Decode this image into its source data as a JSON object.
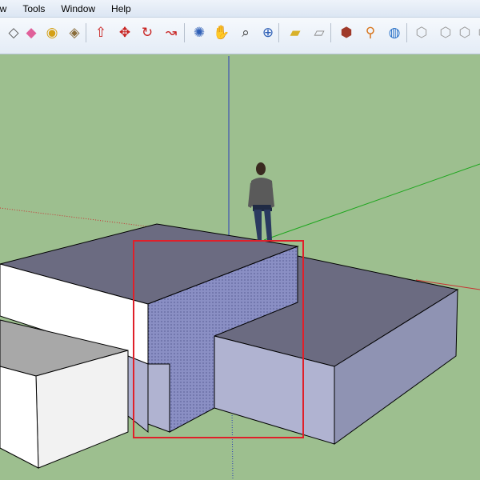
{
  "menu": {
    "items": [
      "aw",
      "Tools",
      "Window",
      "Help"
    ]
  },
  "toolbar": {
    "buttons": [
      {
        "name": "eraser-icon",
        "glyph": "◇",
        "color": "#555"
      },
      {
        "name": "eraser-pink-icon",
        "glyph": "◆",
        "color": "#e0609a"
      },
      {
        "name": "tape-measure-icon",
        "glyph": "◉",
        "color": "#d4a017"
      },
      {
        "name": "paint-bucket-icon",
        "glyph": "◈",
        "color": "#8a6d3b"
      },
      {
        "name": "push-pull-icon",
        "glyph": "⇧",
        "color": "#c8211f"
      },
      {
        "name": "move-icon",
        "glyph": "✥",
        "color": "#c8211f"
      },
      {
        "name": "rotate-icon",
        "glyph": "↻",
        "color": "#c8211f"
      },
      {
        "name": "follow-me-icon",
        "glyph": "↝",
        "color": "#c8211f"
      },
      {
        "name": "orbit-icon",
        "glyph": "✺",
        "color": "#2e5fb6"
      },
      {
        "name": "pan-icon",
        "glyph": "✋",
        "color": "#6a4a2a"
      },
      {
        "name": "zoom-icon",
        "glyph": "⌕",
        "color": "#333"
      },
      {
        "name": "zoom-extents-icon",
        "glyph": "⊕",
        "color": "#2e5fb6"
      },
      {
        "name": "get-models-icon",
        "glyph": "▰",
        "color": "#d8b12a"
      },
      {
        "name": "share-model-icon",
        "glyph": "▱",
        "color": "#888"
      },
      {
        "name": "components-icon",
        "glyph": "⬢",
        "color": "#a03a2a"
      },
      {
        "name": "geolocation-icon",
        "glyph": "⚲",
        "color": "#d8761e"
      },
      {
        "name": "google-earth-icon",
        "glyph": "◍",
        "color": "#2a72c8"
      },
      {
        "name": "iso-view-icon",
        "glyph": "⬡",
        "color": "#999"
      },
      {
        "name": "top-view-icon",
        "glyph": "⬡",
        "color": "#999"
      },
      {
        "name": "front-view-icon",
        "glyph": "⬡",
        "color": "#999"
      },
      {
        "name": "right-view-icon",
        "glyph": "⬡",
        "color": "#999"
      }
    ]
  },
  "colors": {
    "ground": "#9dbf8f",
    "top_face": "#6b6b81",
    "side_face": "#b0b3d1",
    "white_face": "#ffffff",
    "selected_face": "#8a8fc4",
    "selection_box": "#e0202a",
    "blue_axis": "#2a3cb8",
    "green_axis": "#1ea61e",
    "red_axis": "#c83232"
  }
}
